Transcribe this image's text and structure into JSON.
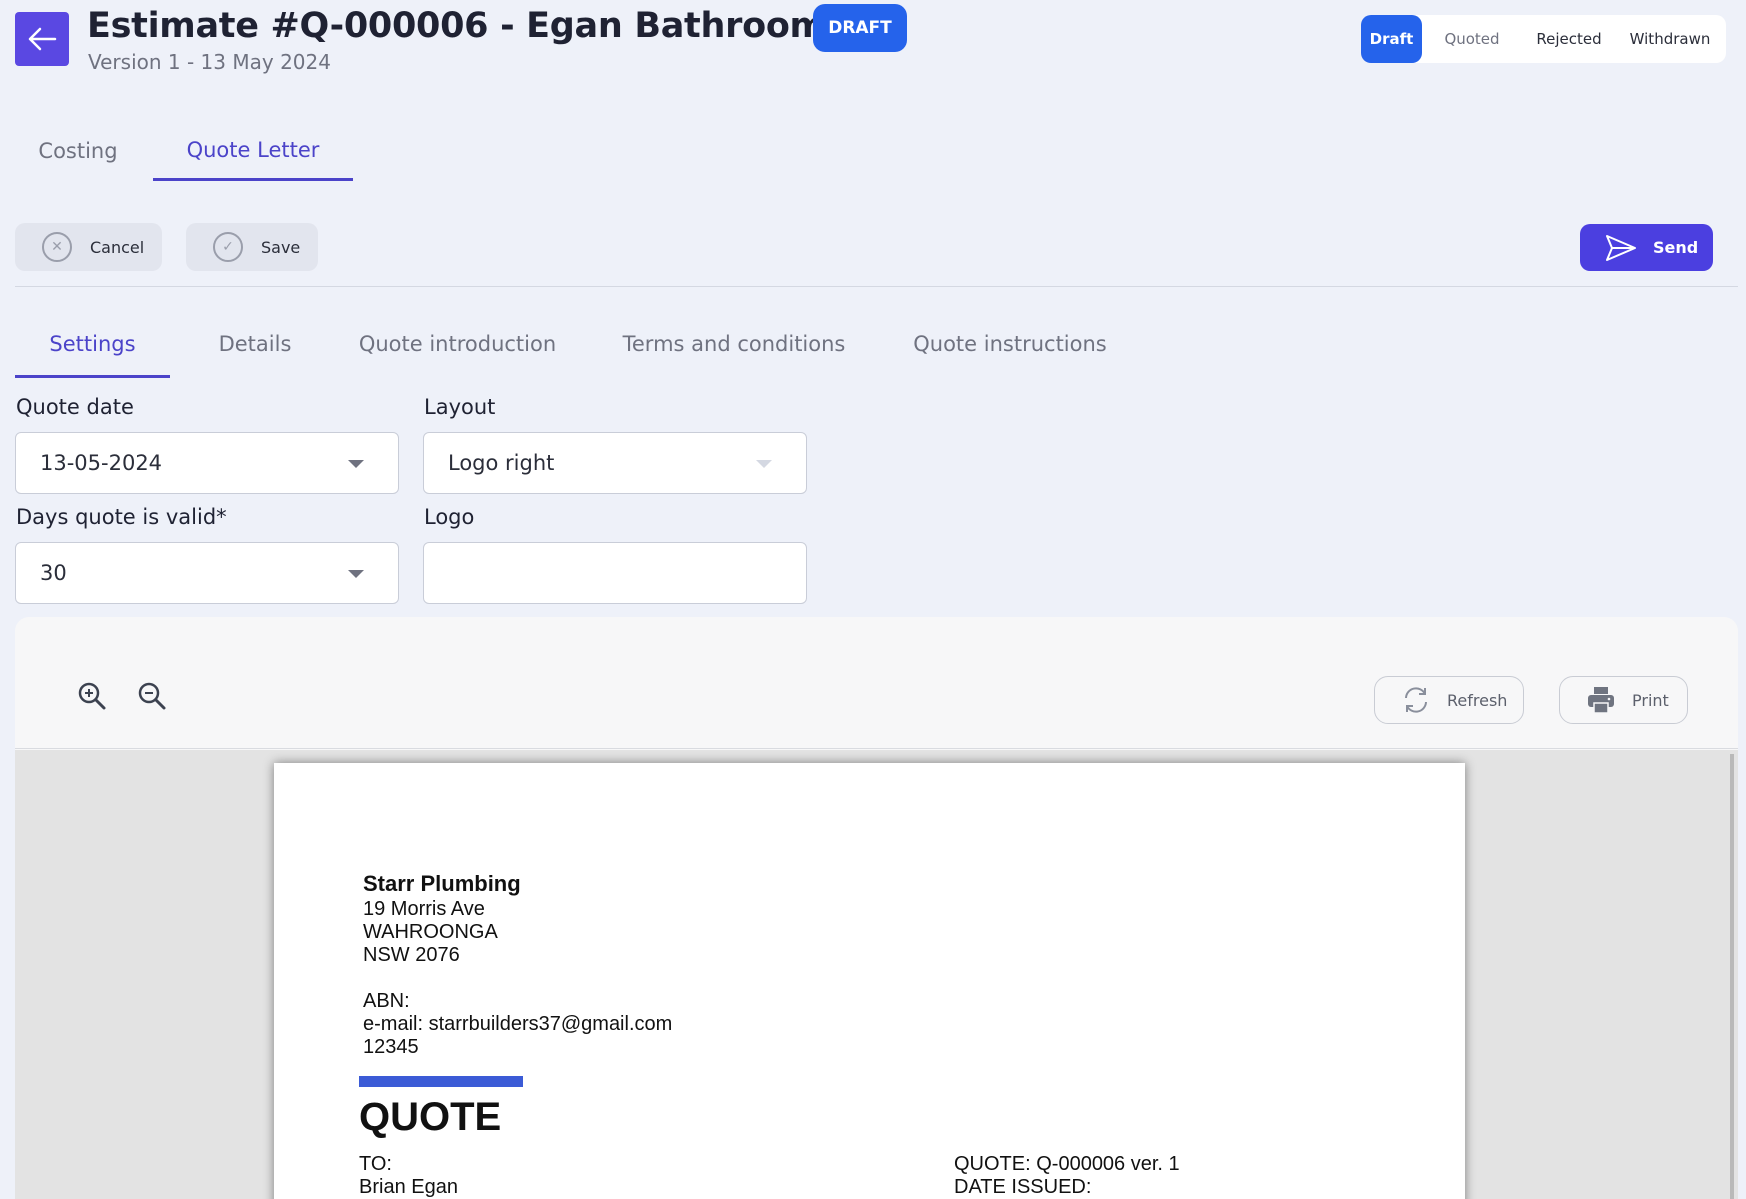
{
  "header": {
    "back_icon": "arrow-left-icon",
    "title": "Estimate #Q-000006 - Egan Bathroom",
    "subtitle": "Version 1 - 13 May 2024",
    "badge": "DRAFT"
  },
  "status_tabs": [
    "Draft",
    "Quoted",
    "Rejected",
    "Withdrawn"
  ],
  "main_tabs": [
    "Costing",
    "Quote Letter"
  ],
  "actions": {
    "cancel": "Cancel",
    "save": "Save",
    "send": "Send"
  },
  "sub_tabs": [
    "Settings",
    "Details",
    "Quote introduction",
    "Terms and conditions",
    "Quote instructions"
  ],
  "form": {
    "quote_date_label": "Quote date",
    "quote_date_value": "13-05-2024",
    "layout_label": "Layout",
    "layout_value": "Logo right",
    "days_valid_label": "Days quote is valid*",
    "days_valid_value": "30",
    "logo_label": "Logo",
    "logo_value": ""
  },
  "preview": {
    "refresh": "Refresh",
    "print": "Print"
  },
  "document": {
    "company": "Starr Plumbing",
    "address1": "19 Morris Ave",
    "address2": "WAHROONGA",
    "address3": "NSW 2076",
    "abn": "ABN:",
    "email": "e-mail: starrbuilders37@gmail.com",
    "phone": "12345",
    "heading": "QUOTE",
    "to_label": "TO:",
    "to_name": "Brian Egan",
    "quote_ref": "QUOTE: Q-000006 ver. 1",
    "date_issued": "DATE ISSUED:"
  },
  "colors": {
    "accent": "#4b43c9",
    "primary_button": "#4b3fe0",
    "draft_blue": "#2563eb",
    "back_button": "#5a48e2",
    "doc_bar": "#3b5bd6"
  }
}
